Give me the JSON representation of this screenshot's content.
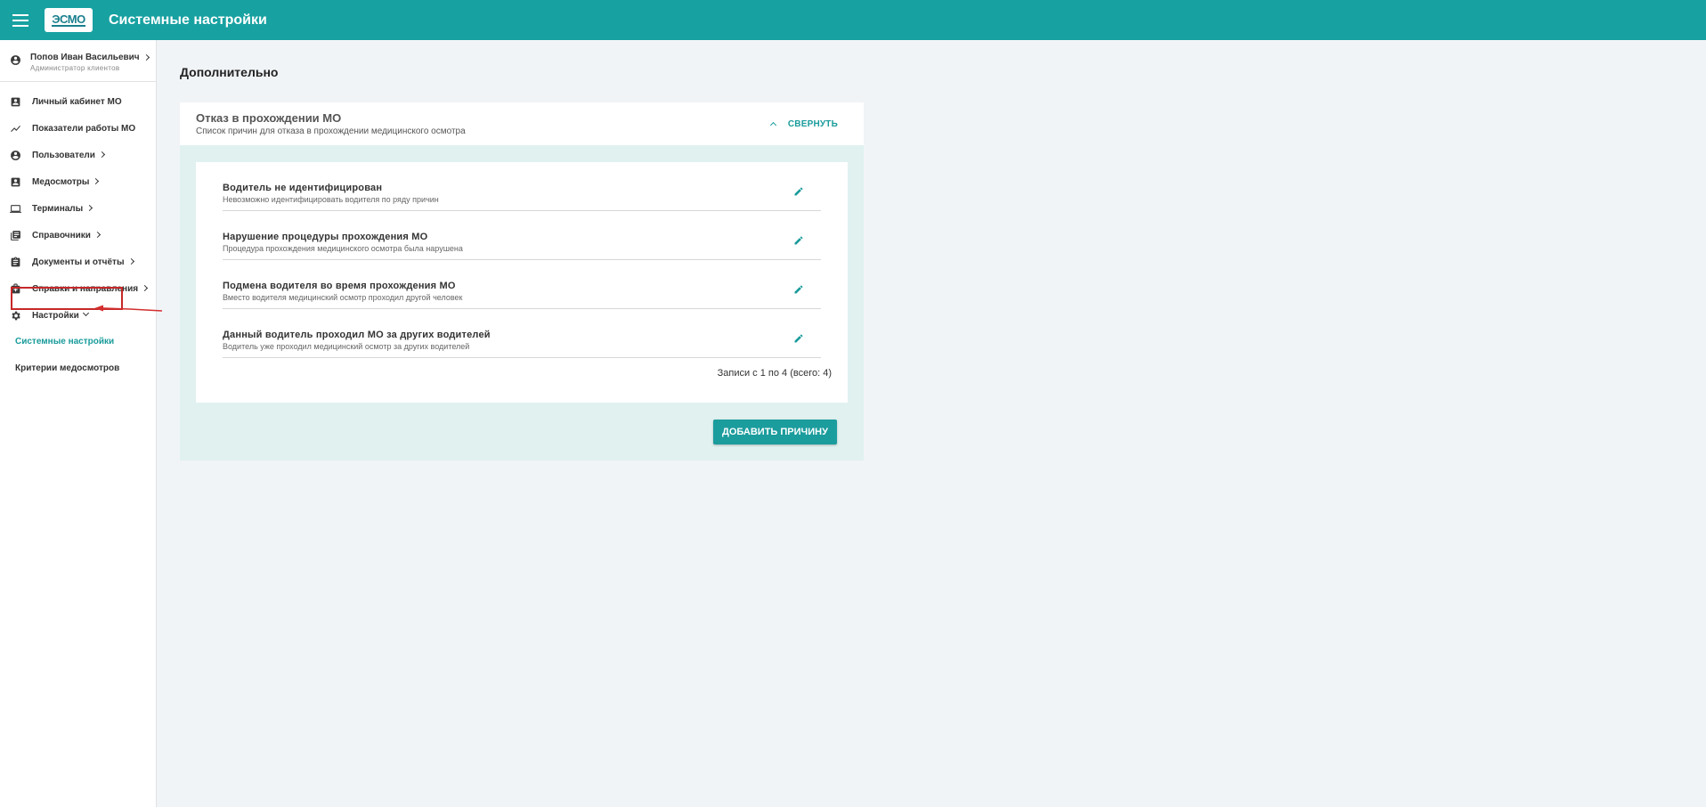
{
  "header": {
    "app_title": "Системные настройки",
    "logo_text": "ЭСМО",
    "menu_icon": "hamburger-icon",
    "color": "#18a1a1"
  },
  "sidebar": {
    "user": {
      "name": "Попов Иван Васильевич",
      "role": "Администратор клиентов",
      "icon": "account-circle-icon"
    },
    "items": [
      {
        "label": "Личный кабинет МО",
        "icon": "badge-icon"
      },
      {
        "label": "Показатели работы МО",
        "icon": "trending-icon"
      },
      {
        "label": "Пользователи",
        "icon": "account-circle-icon"
      },
      {
        "label": "Медосмотры",
        "icon": "contact-card-icon"
      },
      {
        "label": "Терминалы",
        "icon": "laptop-icon"
      },
      {
        "label": "Справочники",
        "icon": "library-books-icon"
      },
      {
        "label": "Документы и отчёты",
        "icon": "assignment-icon"
      },
      {
        "label": "Справки и направления",
        "icon": "medical-bag-icon"
      },
      {
        "label": "Настройки",
        "icon": "gear-icon"
      }
    ],
    "subitems": [
      {
        "label": "Системные настройки",
        "active": true
      },
      {
        "label": "Критерии медосмотров",
        "active": false
      }
    ]
  },
  "main": {
    "section_title": "Дополнительно",
    "panel": {
      "title": "Отказ в прохождении МО",
      "subtitle": "Список причин для отказа в прохождении медицинского осмотра",
      "collapse_label": "СВЕРНУТЬ",
      "rows": [
        {
          "title": "Водитель не идентифицирован",
          "desc": "Невозможно идентифицировать водителя по ряду причин"
        },
        {
          "title": "Нарушение процедуры прохождения МО",
          "desc": "Процедура прохождения медицинского осмотра была нарушена"
        },
        {
          "title": "Подмена водителя во время прохождения МО",
          "desc": "Вместо водителя медицинский осмотр проходил другой человек"
        },
        {
          "title": "Данный водитель проходил МО за других водителей",
          "desc": "Водитель уже проходил медицинский осмотр за других водителей"
        }
      ],
      "records_text": "Записи с 1 по 4 (всего: 4)",
      "add_button": "ДОБАВИТЬ ПРИЧИНУ"
    }
  }
}
